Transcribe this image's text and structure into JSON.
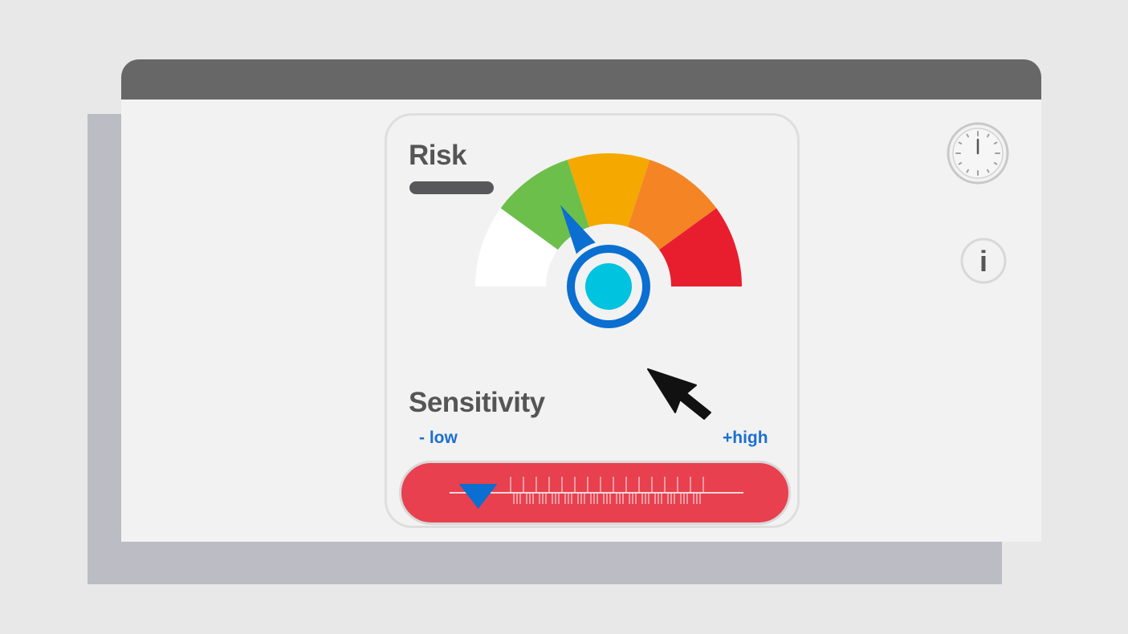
{
  "risk": {
    "title": "Risk",
    "level_fraction": 0.33,
    "segment_colors": [
      "#ffffff",
      "#6cbf4b",
      "#f5a800",
      "#f48424",
      "#e81e2f"
    ],
    "needle_color": "#0a6fd0",
    "hub_color": "#00c3df"
  },
  "sensitivity": {
    "title": "Sensitivity",
    "low_label": "- low",
    "high_label": "+high",
    "value_fraction": 0.07,
    "track_color": "#e8404e",
    "thumb_color": "#0a6fd0"
  },
  "toolbar": {
    "clock_icon": "clock-icon",
    "info_icon": "info-icon",
    "info_glyph": "i"
  },
  "colors": {
    "titlebar": "#676767",
    "window": "#f2f2f2",
    "shadow": "#bcbcc5"
  }
}
